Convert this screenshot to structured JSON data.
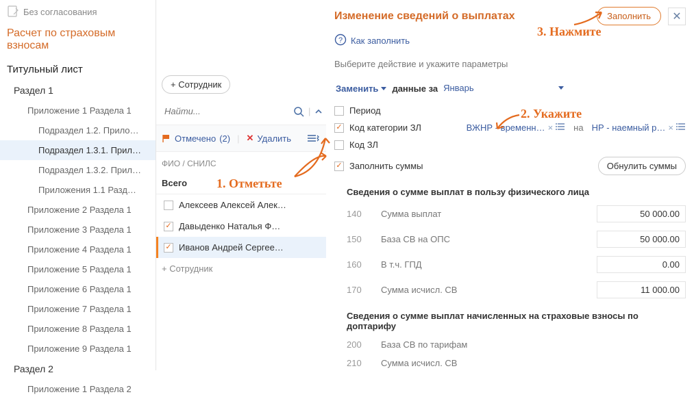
{
  "status_text": "Без согласования",
  "report_title": "Расчет по страховым взносам",
  "nav": [
    {
      "label": "Титульный лист",
      "level": 0
    },
    {
      "label": "Раздел 1",
      "level": 1
    },
    {
      "label": "Приложение 1 Раздела 1",
      "level": 2
    },
    {
      "label": "Подраздел 1.2. Прило…",
      "level": 3
    },
    {
      "label": "Подраздел 1.3.1. Прил…",
      "level": 3,
      "active": true
    },
    {
      "label": "Подраздел 1.3.2. Прил…",
      "level": 3
    },
    {
      "label": "Приложения 1.1 Разд…",
      "level": 3
    },
    {
      "label": "Приложение 2 Раздела 1",
      "level": 2
    },
    {
      "label": "Приложение 3 Раздела 1",
      "level": 2
    },
    {
      "label": "Приложение 4 Раздела 1",
      "level": 2
    },
    {
      "label": "Приложение 5 Раздела 1",
      "level": 2
    },
    {
      "label": "Приложение 6 Раздела 1",
      "level": 2
    },
    {
      "label": "Приложение 7 Раздела 1",
      "level": 2
    },
    {
      "label": "Приложение 8 Раздела 1",
      "level": 2
    },
    {
      "label": "Приложение 9 Раздела 1",
      "level": 2
    },
    {
      "label": "Раздел 2",
      "level": 1
    },
    {
      "label": "Приложение 1 Раздела 2",
      "level": 2
    }
  ],
  "middle": {
    "add_employee": "+ Сотрудник",
    "search_placeholder": "Найти...",
    "marked_label": "Отмечено",
    "marked_count": "(2)",
    "delete_label": "Удалить",
    "col_header": "ФИО / СНИЛС",
    "total_label": "Всего",
    "employees": [
      {
        "name": "Алексеев Алексей Алек…",
        "checked": false,
        "selected": false
      },
      {
        "name": "Давыденко Наталья Ф…",
        "checked": true,
        "selected": false
      },
      {
        "name": "Иванов Андрей Сергее…",
        "checked": true,
        "selected": true
      }
    ],
    "add_employee_bottom": "+ Сотрудник"
  },
  "right": {
    "title": "Изменение сведений о выплатах",
    "fill_btn": "Заполнить",
    "help_link": "Как заполнить",
    "hint": "Выберите действие и укажите параметры",
    "action_dropdown": "Заменить",
    "action_mid": "данные за",
    "month_dropdown": "Январь",
    "chk_period": "Период",
    "chk_code_cat": "Код категории ЗЛ",
    "code_cat_from": "ВЖНР - временн…",
    "code_cat_on": "на",
    "code_cat_to": "НР - наемный р…",
    "chk_code_zl": "Код ЗЛ",
    "chk_fill_sums": "Заполнить суммы",
    "reset_sums_btn": "Обнулить суммы",
    "section1_head": "Сведения о сумме выплат в пользу физического лица",
    "rows1": [
      {
        "code": "140",
        "label": "Сумма выплат",
        "value": "50 000.00"
      },
      {
        "code": "150",
        "label": "База СВ на ОПС",
        "value": "50 000.00"
      },
      {
        "code": "160",
        "label": "В т.ч. ГПД",
        "value": "0.00"
      },
      {
        "code": "170",
        "label": "Сумма исчисл. СВ",
        "value": "11 000.00"
      }
    ],
    "section2_head": "Сведения о сумме выплат начисленных на страховые взносы по доптарифу",
    "rows2": [
      {
        "code": "200",
        "label": "База СВ по тарифам",
        "value": ""
      },
      {
        "code": "210",
        "label": "Сумма исчисл. СВ",
        "value": ""
      }
    ]
  },
  "annotations": {
    "a1": "1. Отметьте",
    "a2": "2. Укажите",
    "a3": "3. Нажмите"
  }
}
